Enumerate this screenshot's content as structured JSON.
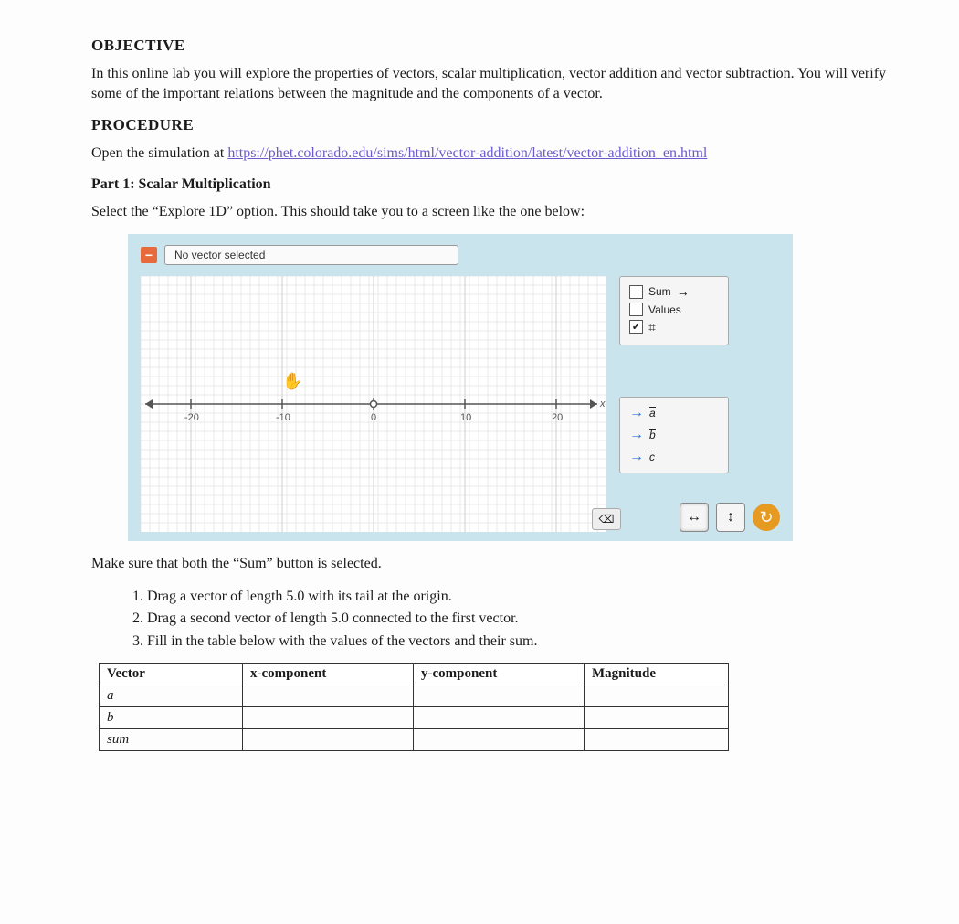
{
  "objective": {
    "heading": "OBJECTIVE",
    "text": "In this online lab you will explore the properties of vectors, scalar multiplication, vector addition and vector subtraction. You will verify some of the important relations between the magnitude and the components of a vector."
  },
  "procedure": {
    "heading": "PROCEDURE",
    "open_text_pre": "Open the simulation at ",
    "link_text": "https://phet.colorado.edu/sims/html/vector-addition/latest/vector-addition_en.html",
    "part1_heading": "Part 1: Scalar Multiplication",
    "part1_text": "Select the “Explore 1D” option. This should take you to a screen like the one below:"
  },
  "sim": {
    "top_label": "No vector selected",
    "axis": {
      "ticks": [
        "-20",
        "-10",
        "0",
        "10",
        "20"
      ],
      "x_label": "x"
    },
    "options": {
      "sum_label": "Sum",
      "values_label": "Values",
      "sum_checked": false,
      "values_checked": false,
      "grid_checked": true
    },
    "vectors": {
      "a_label": "a",
      "b_label": "b",
      "c_label": "c"
    }
  },
  "after_sim": {
    "make_sure": "Make sure that both the “Sum” button is selected.",
    "steps": [
      "Drag a vector of length 5.0 with its tail at the origin.",
      "Drag a second vector of length 5.0 connected to the first vector.",
      "Fill in the table below with the values of the vectors and their sum."
    ]
  },
  "table": {
    "headers": {
      "vector": "Vector",
      "xcomp": "x-component",
      "ycomp": "y-component",
      "mag": "Magnitude"
    },
    "rows": {
      "a": "a",
      "b": "b",
      "sum": "sum"
    }
  }
}
